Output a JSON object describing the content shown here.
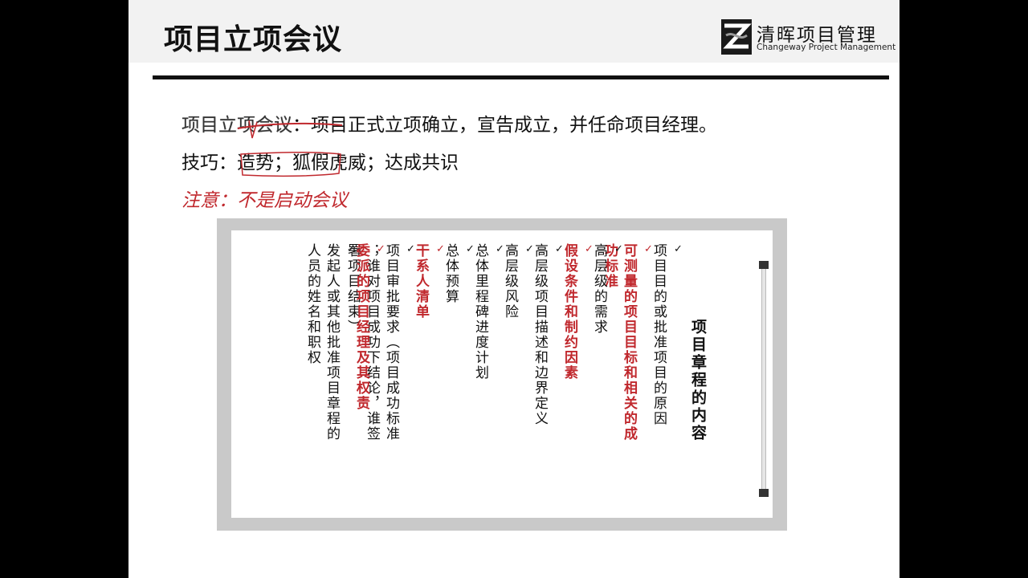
{
  "header": {
    "title": "项目立项会议",
    "logo_cn": "清晖项目管理",
    "logo_en": "Changeway Project Management"
  },
  "body": {
    "line1_term": "项目立项会议",
    "line1_rest": "：项目正式立项确立，宣告成立，并任命项目经理。",
    "line2": "技巧：造势；狐假虎威；达成共识",
    "note": "注意：不是启动会议"
  },
  "charter": {
    "heading": "项目章程的内容",
    "check_mark": "✓",
    "items": [
      {
        "text": "项目目的或批准项目的原因",
        "highlight": false
      },
      {
        "text": "可测量的项目目标和相关的成功标准",
        "highlight": true
      },
      {
        "text": "高层级的需求",
        "highlight": false
      },
      {
        "text": "假设条件和制约因素",
        "highlight": true
      },
      {
        "text": "高层级项目描述和边界定义",
        "highlight": false
      },
      {
        "text": "高层级风险",
        "highlight": false
      },
      {
        "text": "总体里程碑进度计划",
        "highlight": false
      },
      {
        "text": "总体预算",
        "highlight": false
      },
      {
        "text": "干系人清单",
        "highlight": true
      },
      {
        "text": "项目审批要求（项目成功标准；谁对项目成功下结论，谁签署项目结束）",
        "highlight": false
      },
      {
        "text": "委派的项目经理及其权责",
        "highlight": true
      },
      {
        "text": "发起人或其他批准项目章程的人员的姓名和职权",
        "highlight": false
      }
    ]
  },
  "colors": {
    "accent_red": "#c0282d",
    "text": "#111111"
  }
}
